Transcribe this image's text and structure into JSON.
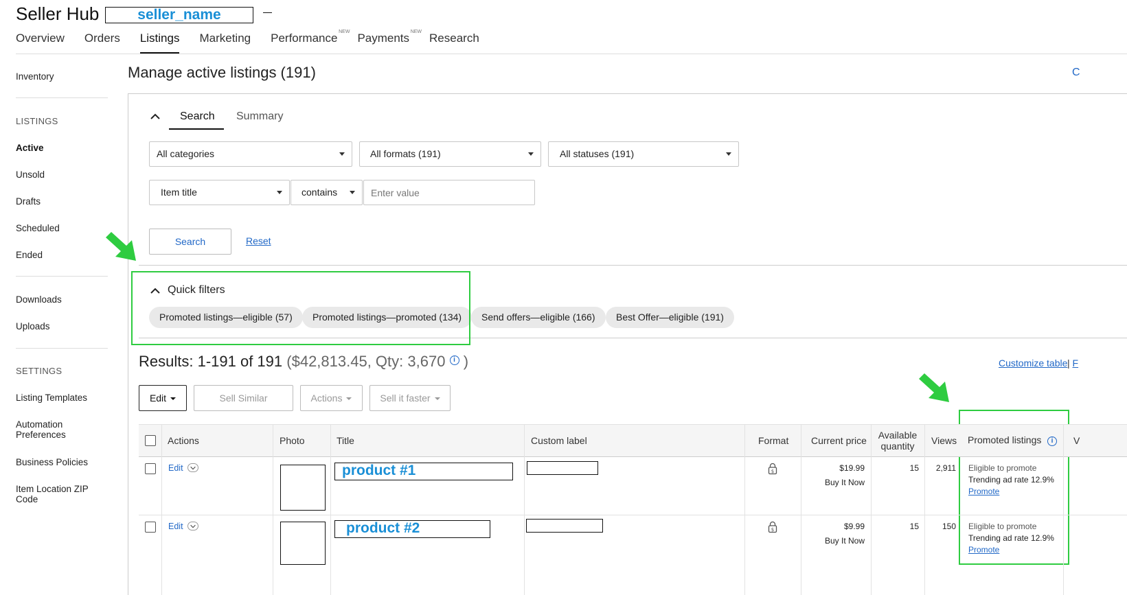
{
  "header": {
    "title": "Seller Hub",
    "seller_name": "seller_name"
  },
  "topnav": [
    {
      "label": "Overview",
      "active": false,
      "new": ""
    },
    {
      "label": "Orders",
      "active": false,
      "new": ""
    },
    {
      "label": "Listings",
      "active": true,
      "new": ""
    },
    {
      "label": "Marketing",
      "active": false,
      "new": ""
    },
    {
      "label": "Performance",
      "active": false,
      "new": "NEW"
    },
    {
      "label": "Payments",
      "active": false,
      "new": "NEW"
    },
    {
      "label": "Research",
      "active": false,
      "new": ""
    }
  ],
  "sidebar": {
    "inventory": "Inventory",
    "listings_heading": "LISTINGS",
    "listings": [
      "Active",
      "Unsold",
      "Drafts",
      "Scheduled",
      "Ended"
    ],
    "files": [
      "Downloads",
      "Uploads"
    ],
    "settings_heading": "SETTINGS",
    "settings": [
      "Listing Templates",
      "Automation Preferences",
      "Business Policies",
      "Item Location ZIP Code"
    ]
  },
  "page": {
    "title": "Manage active listings (191)",
    "right_link": "C"
  },
  "search_panel": {
    "tabs": [
      "Search",
      "Summary"
    ],
    "category_select": "All categories",
    "format_select": "All formats (191)",
    "status_select": "All statuses (191)",
    "field_select": "Item title",
    "operator_select": "contains",
    "value_placeholder": "Enter value",
    "search_button": "Search",
    "reset_link": "Reset"
  },
  "quick_filters": {
    "title": "Quick filters",
    "pills": [
      "Promoted listings—eligible (57)",
      "Promoted listings—promoted (134)",
      "Send offers—eligible (166)",
      "Best Offer—eligible (191)"
    ]
  },
  "results": {
    "summary": "Results: 1-191 of 191",
    "totals": "($42,813.45, Qty: 3,670",
    "close_paren": ")",
    "info": "i",
    "customize_link": "Customize table",
    "separator": "|",
    "more_link": "F"
  },
  "toolbar": {
    "edit": "Edit",
    "sell_similar": "Sell Similar",
    "actions": "Actions",
    "sell_faster": "Sell it faster"
  },
  "table": {
    "headers": {
      "actions": "Actions",
      "photo": "Photo",
      "title": "Title",
      "custom_label": "Custom label",
      "format": "Format",
      "current_price": "Current price",
      "available_quantity": "Available quantity",
      "views": "Views",
      "promoted": "Promoted listings",
      "next": "V"
    },
    "rows": [
      {
        "edit": "Edit",
        "title": "product #1",
        "price": "$19.99",
        "format": "Buy It Now",
        "quantity": "15",
        "views": "2,911",
        "promo_status": "Eligible to promote",
        "promo_rate": "Trending ad rate 12.9%",
        "promo_link": "Promote"
      },
      {
        "edit": "Edit",
        "title": "product #2",
        "price": "$9.99",
        "format": "Buy It Now",
        "quantity": "15",
        "views": "150",
        "promo_status": "Eligible to promote",
        "promo_rate": "Trending ad rate 12.9%",
        "promo_link": "Promote"
      }
    ]
  },
  "colors": {
    "link": "#2168c7",
    "highlight": "#2ecc40",
    "redaction_text": "#1a8fd6",
    "pill_bg": "#e9e9e9"
  }
}
